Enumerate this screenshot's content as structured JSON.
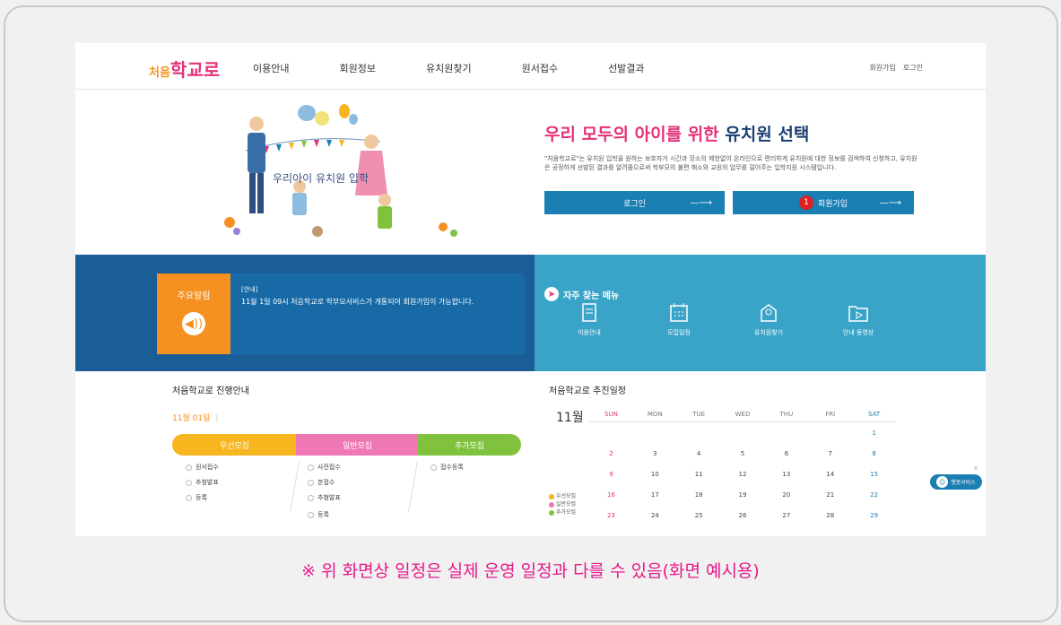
{
  "header": {
    "logo_a": "처음",
    "logo_b": "학교로",
    "nav": [
      "이용안내",
      "회원정보",
      "유치원찾기",
      "원서접수",
      "선발결과"
    ],
    "util": [
      "회원가입",
      "로그인"
    ]
  },
  "hero": {
    "title_a": "우리 모두의 ",
    "title_b": "아이를 위한 ",
    "title_c": "유치원 선택",
    "desc": "\"처음학교로\"는 유치원 입학을 원하는 보호자가 시간과 장소의 제한없이 온라인으로 편리하게 유치원에 대한 정보를 검색하여 신청하고, 유치원은 공정하게 선발된 결과를 알려줌으로써 학부모의 불편 해소와 교원의 업무를 덜어주는 입학지원 시스템입니다.",
    "login_label": "로그인",
    "join_label": "회원가입",
    "join_badge": "1",
    "arrow": "—⟶",
    "illus_text": "우리아이 유치원 입학"
  },
  "notice": {
    "label": "주요알림",
    "tag": "[안내]",
    "text": "11월 1일 09시 처음학교로 학부모서비스가 개통되어 회원가입이 가능합니다."
  },
  "quick": {
    "title": "자주 찾는 메뉴",
    "items": [
      "이용안내",
      "모집일정",
      "유치원찾기",
      "안내 동영상"
    ]
  },
  "progress": {
    "title": "처음학교로 진행안내",
    "date": "11월 01일",
    "date_sep": "|",
    "pills": [
      "우선모집",
      "일반모집",
      "추가모집"
    ],
    "col1": [
      "원서접수",
      "추첨발표",
      "등록"
    ],
    "col2": [
      "사전접수",
      "본접수",
      "추첨발표",
      "등록"
    ],
    "col3": [
      "접수등록"
    ]
  },
  "calendar": {
    "title": "처음학교로 추진일정",
    "month": "11월",
    "days": [
      "SUN",
      "MON",
      "TUE",
      "WED",
      "THU",
      "FRI",
      "SAT"
    ],
    "weeks": [
      [
        "",
        "",
        "",
        "",
        "",
        "",
        "1"
      ],
      [
        "2",
        "3",
        "4",
        "5",
        "6",
        "7",
        "8"
      ],
      [
        "9",
        "10",
        "11",
        "12",
        "13",
        "14",
        "15"
      ],
      [
        "16",
        "17",
        "18",
        "19",
        "20",
        "21",
        "22"
      ],
      [
        "23",
        "24",
        "25",
        "26",
        "27",
        "28",
        "29"
      ]
    ],
    "legend": [
      "우선모집",
      "일반모집",
      "추가모집"
    ]
  },
  "chatbot": {
    "label": "챗봇서비스",
    "close": "×"
  },
  "footnote": "※ 위 화면상 일정은 실제 운영 일정과 다를 수 있음(화면 예시용)",
  "colors": {
    "primary": "#1a7fb3",
    "pink": "#e3317a",
    "orange": "#f59021",
    "yellow": "#f7b51e",
    "green": "#80c23e"
  }
}
